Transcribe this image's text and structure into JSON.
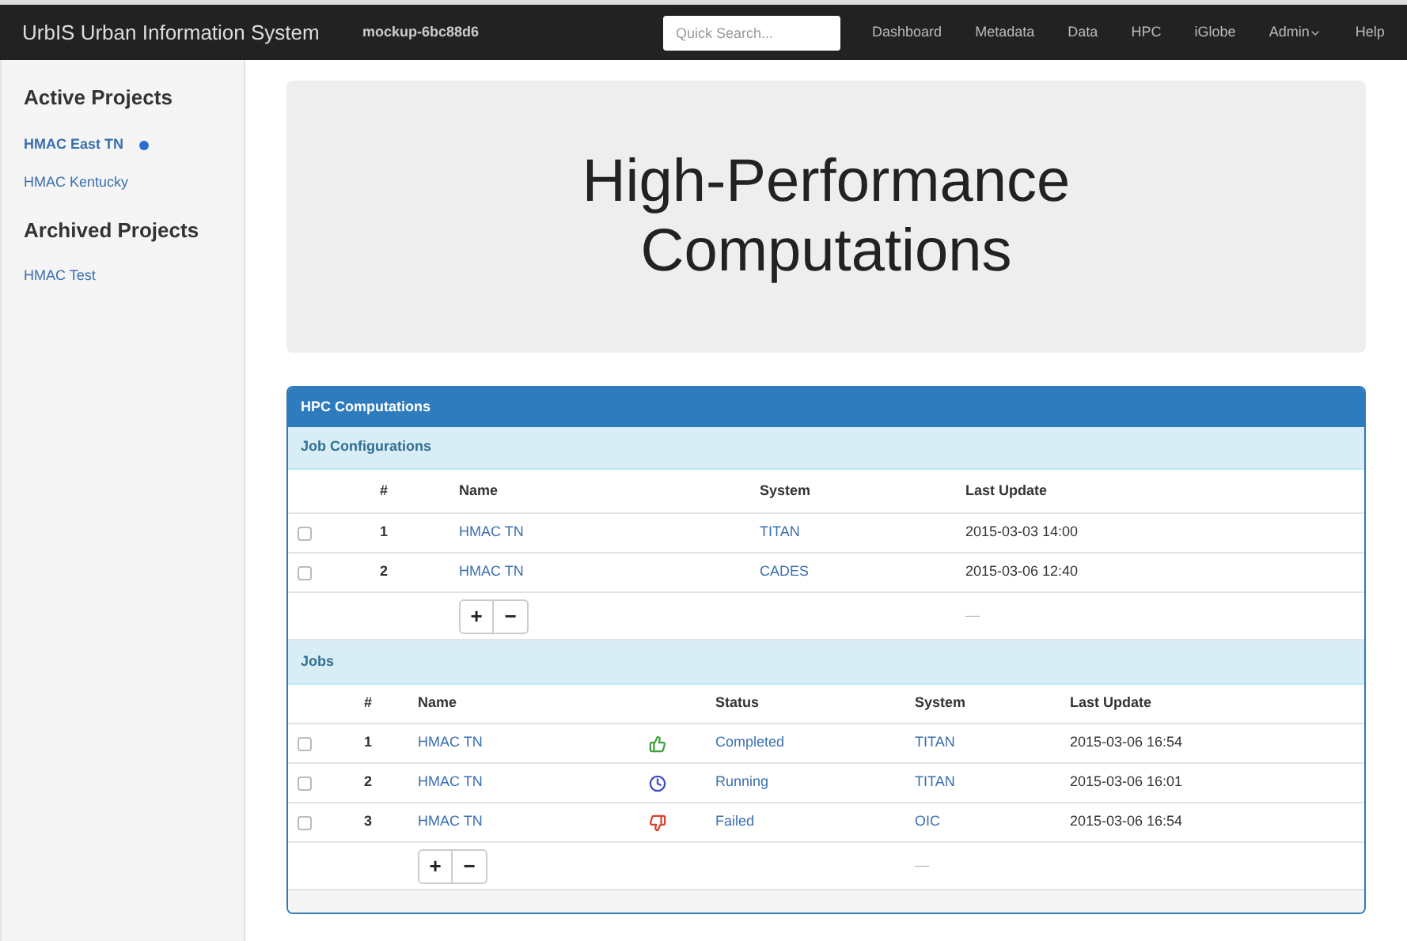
{
  "navbar": {
    "brand": "UrbIS Urban Information System",
    "instance": "mockup-6bc88d6",
    "search": {
      "placeholder": "Quick Search..."
    },
    "links": [
      {
        "label": "Dashboard",
        "dropdown": false
      },
      {
        "label": "Metadata",
        "dropdown": false
      },
      {
        "label": "Data",
        "dropdown": false
      },
      {
        "label": "HPC",
        "dropdown": false
      },
      {
        "label": "iGlobe",
        "dropdown": false
      },
      {
        "label": "Admin",
        "dropdown": true
      },
      {
        "label": "Help",
        "dropdown": false
      }
    ]
  },
  "sidebar": {
    "sections": [
      {
        "title": "Active Projects",
        "items": [
          {
            "label": "HMAC East TN",
            "selected": true
          },
          {
            "label": "HMAC Kentucky",
            "selected": false
          }
        ]
      },
      {
        "title": "Archived Projects",
        "items": [
          {
            "label": "HMAC Test",
            "selected": false
          }
        ]
      }
    ]
  },
  "hero": {
    "title": "High-Performance Computations"
  },
  "panel": {
    "title": "HPC Computations",
    "job_configurations": {
      "title": "Job Configurations",
      "columns": [
        "#",
        "Name",
        "System",
        "Last Update"
      ],
      "rows": [
        {
          "checked": false,
          "number": "1",
          "name": "HMAC TN",
          "system": "TITAN",
          "last_update": "2015-03-03 14:00"
        },
        {
          "checked": false,
          "number": "2",
          "name": "HMAC TN",
          "system": "CADES",
          "last_update": "2015-03-06 12:40"
        }
      ],
      "add": "+",
      "remove": "−",
      "footer": "—"
    },
    "jobs": {
      "title": "Jobs",
      "columns": [
        "#",
        "Name",
        "Status",
        "System",
        "Last Update"
      ],
      "rows": [
        {
          "checked": false,
          "number": "1",
          "name": "HMAC TN",
          "kind": "completed",
          "status": "Completed",
          "system": "TITAN",
          "last_update": "2015-03-06 16:54"
        },
        {
          "checked": false,
          "number": "2",
          "name": "HMAC TN",
          "kind": "running",
          "status": "Running",
          "system": "TITAN",
          "last_update": "2015-03-06 16:01"
        },
        {
          "checked": false,
          "number": "3",
          "name": "HMAC TN",
          "kind": "failed",
          "status": "Failed",
          "system": "OIC",
          "last_update": "2015-03-06 16:54"
        }
      ],
      "add": "+",
      "remove": "−",
      "footer": "—"
    }
  }
}
